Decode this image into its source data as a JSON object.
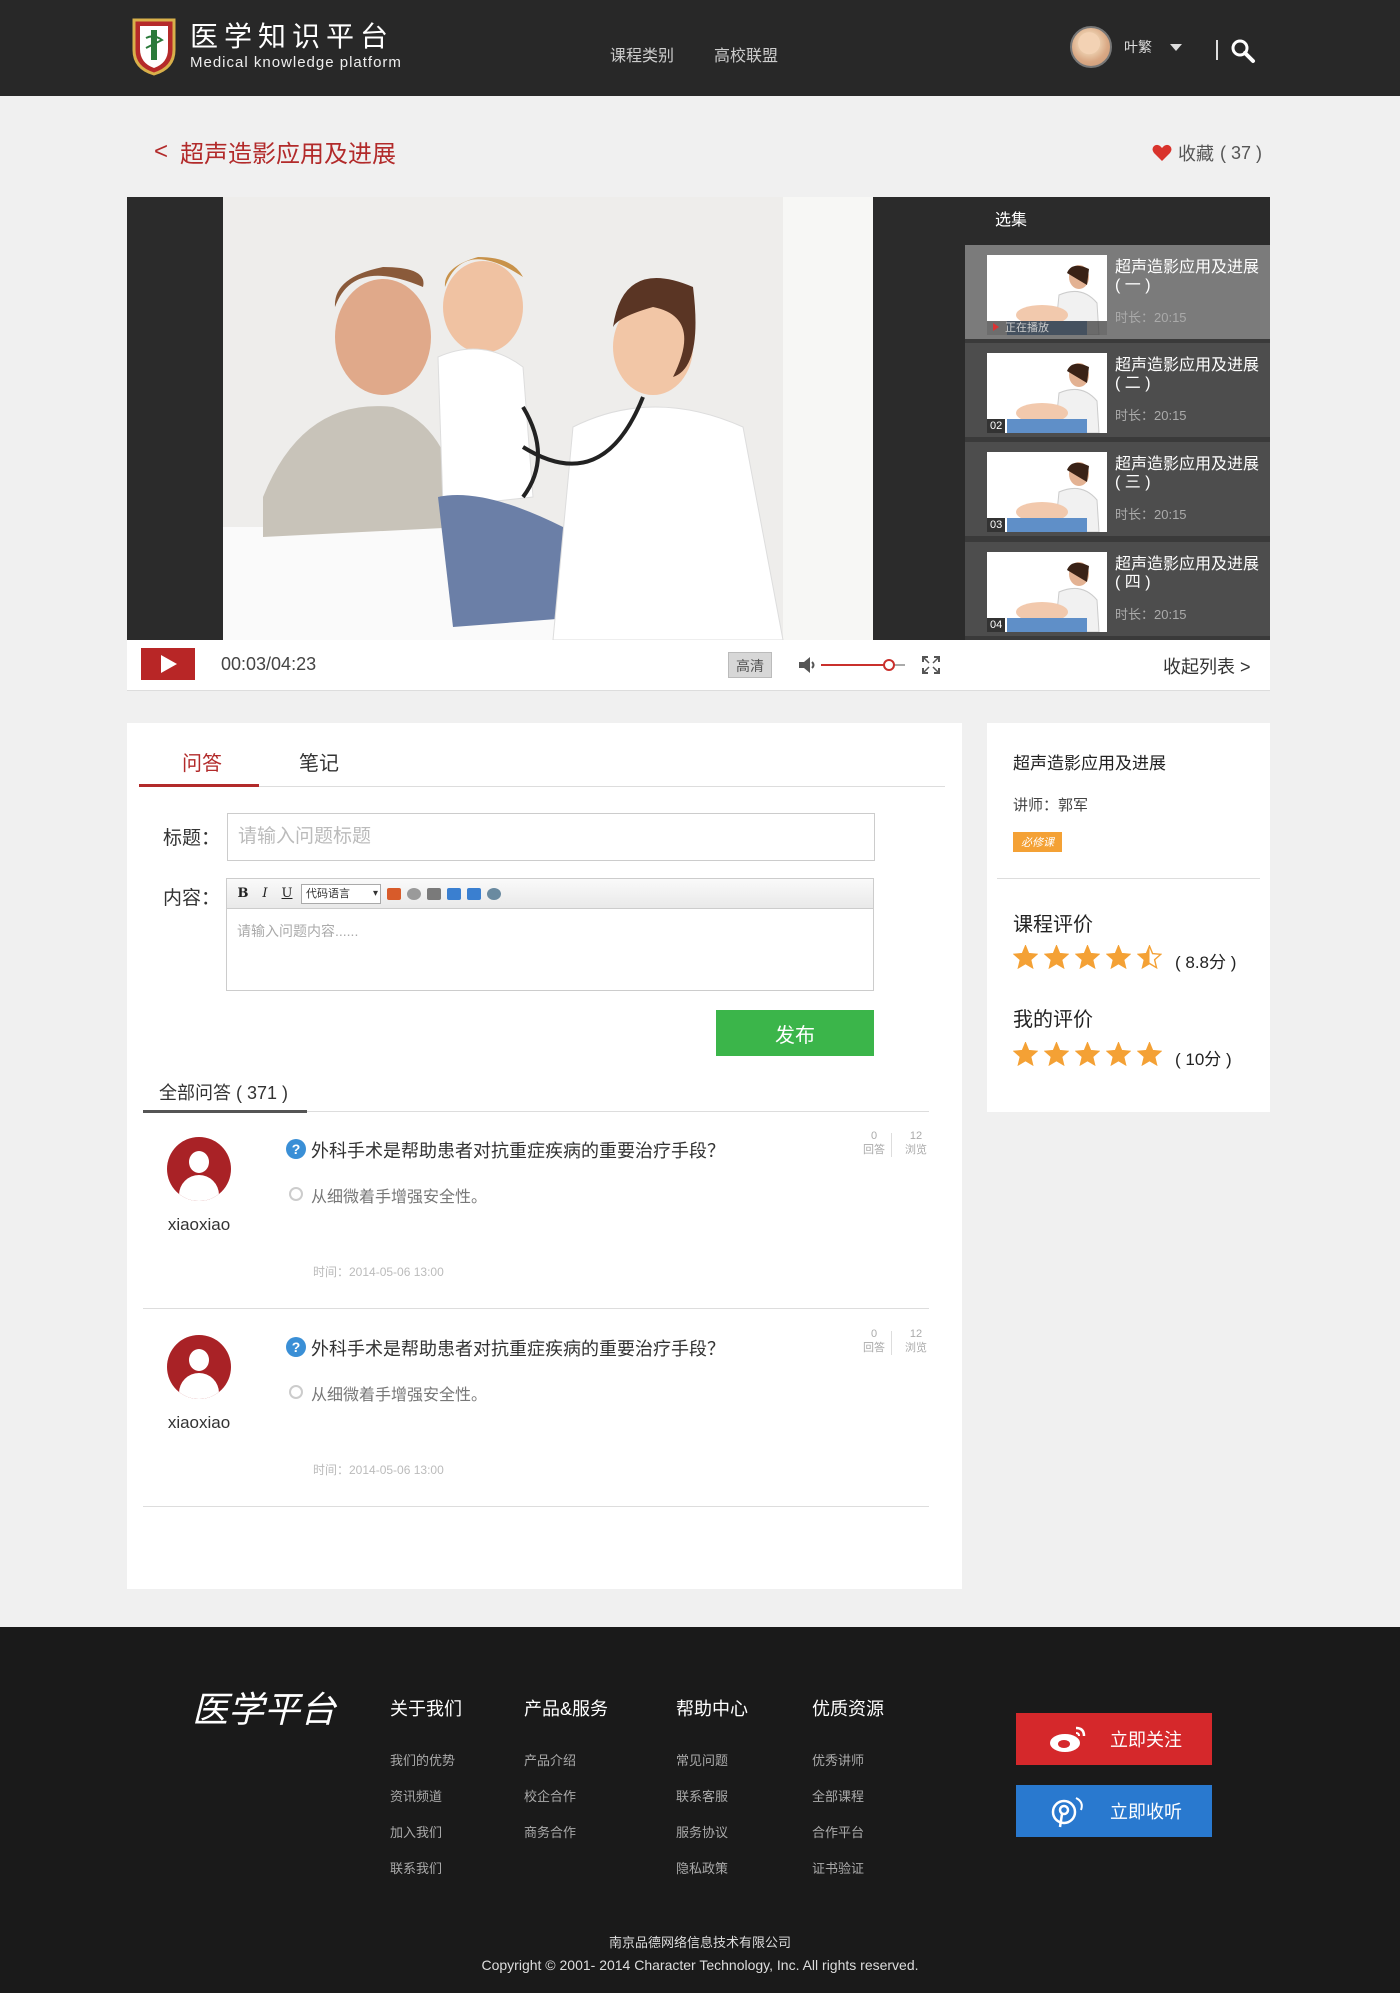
{
  "header": {
    "logo_cn": "医学知识平台",
    "logo_en": "Medical knowledge platform",
    "nav": [
      "课程类别",
      "高校联盟"
    ],
    "username": "叶繁"
  },
  "course": {
    "back_symbol": "<",
    "title": "超声造影应用及进展",
    "favorite_label": "收藏",
    "favorite_count": "( 37 )"
  },
  "player": {
    "episodes_label": "选集",
    "episodes": [
      {
        "title": "超声造影应用及进展",
        "part": "( 一 )",
        "duration": "时长：20:15",
        "badge": "正在播放"
      },
      {
        "title": "超声造影应用及进展",
        "part": "( 二 )",
        "duration": "时长：20:15",
        "badge": "02"
      },
      {
        "title": "超声造影应用及进展",
        "part": "( 三 )",
        "duration": "时长：20:15",
        "badge": "03"
      },
      {
        "title": "超声造影应用及进展",
        "part": "( 四 )",
        "duration": "时长：20:15",
        "badge": "04"
      }
    ],
    "time": "00:03/04:23",
    "quality": "高清",
    "volume_fraction": 0.85,
    "collapse_label": "收起列表 >"
  },
  "qa": {
    "tabs": [
      "问答",
      "笔记"
    ],
    "title_label": "标题：",
    "title_placeholder": "请输入问题标题",
    "content_label": "内容：",
    "editor_toolbar": [
      "B",
      "I",
      "U",
      "代码语言"
    ],
    "content_placeholder": "请输入问题内容......",
    "publish_label": "发布",
    "all_label": "全部问答 ( 371 )",
    "items": [
      {
        "user": "xiaoxiao",
        "question": "外科手术是帮助患者对抗重症疾病的重要治疗手段？",
        "answer": "从细微着手增强安全性。",
        "time": "时间：2014-05-06   13:00",
        "answers": "0",
        "answers_label": "回答",
        "views": "12",
        "views_label": "浏览"
      },
      {
        "user": "xiaoxiao",
        "question": "外科手术是帮助患者对抗重症疾病的重要治疗手段？",
        "answer": "从细微着手增强安全性。",
        "time": "时间：2014-05-06   13:00",
        "answers": "0",
        "answers_label": "回答",
        "views": "12",
        "views_label": "浏览"
      }
    ]
  },
  "info": {
    "title": "超声造影应用及进展",
    "teacher": "讲师：郭军",
    "badge": "必修课",
    "rating_label": "课程评价",
    "rating_stars": 4.5,
    "rating_score": "( 8.8分 )",
    "my_rating_label": "我的评价",
    "my_rating_stars": 5,
    "my_rating_score": "( 10分 )",
    "star_color": "#f4a135"
  },
  "footer": {
    "brand": "医学平台",
    "columns": [
      {
        "title": "关于我们",
        "links": [
          "我们的优势",
          "资讯频道",
          "加入我们",
          "联系我们"
        ]
      },
      {
        "title": "产品&服务",
        "links": [
          "产品介绍",
          "校企合作",
          "商务合作"
        ]
      },
      {
        "title": "帮助中心",
        "links": [
          "常见问题",
          "联系客服",
          "服务协议",
          "隐私政策"
        ]
      },
      {
        "title": "优质资源",
        "links": [
          "优秀讲师",
          "全部课程",
          "合作平台",
          "证书验证"
        ]
      }
    ],
    "follow_label": "立即关注",
    "listen_label": "立即收听",
    "company": "南京品德网络信息技术有限公司",
    "copyright": "Copyright © 2001- 2014 Character Technology, Inc. All rights reserved."
  },
  "colors": {
    "accent": "#b22a2a",
    "header_bg": "#282828",
    "publish": "#3bb54a",
    "weibo": "#d5282b",
    "listen": "#2979cf"
  }
}
